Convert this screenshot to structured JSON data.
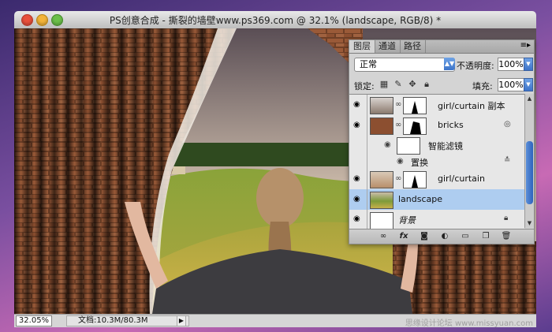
{
  "window": {
    "title": "PS创意合成 - 撕裂的墙壁www.ps369.com @ 32.1% (landscape, RGB/8) *"
  },
  "status": {
    "zoom": "32.05%",
    "doc_info": "文档:10.3M/80.3M",
    "watermark": "思缘设计论坛  www.missyuan.com"
  },
  "panel": {
    "tabs": [
      "图层",
      "通道",
      "路径"
    ],
    "blend_mode": "正常",
    "opacity_label": "不透明度:",
    "opacity_value": "100%",
    "lock_label": "锁定:",
    "fill_label": "填充:",
    "fill_value": "100%",
    "layers": [
      {
        "name": "girl/curtain 副本",
        "selected": false
      },
      {
        "name": "bricks",
        "selected": false
      },
      {
        "name": "智能滤镜",
        "selected": false
      },
      {
        "name": "置换",
        "selected": false
      },
      {
        "name": "girl/curtain",
        "selected": false
      },
      {
        "name": "landscape",
        "selected": true
      },
      {
        "name": "背景",
        "selected": false
      }
    ],
    "footer_icons": [
      "link-icon",
      "fx-icon",
      "mask-icon",
      "adjustment-icon",
      "folder-icon",
      "new-layer-icon",
      "trash-icon"
    ]
  },
  "colors": {
    "selection": "#aecdf0",
    "accent": "#3c73c9"
  }
}
